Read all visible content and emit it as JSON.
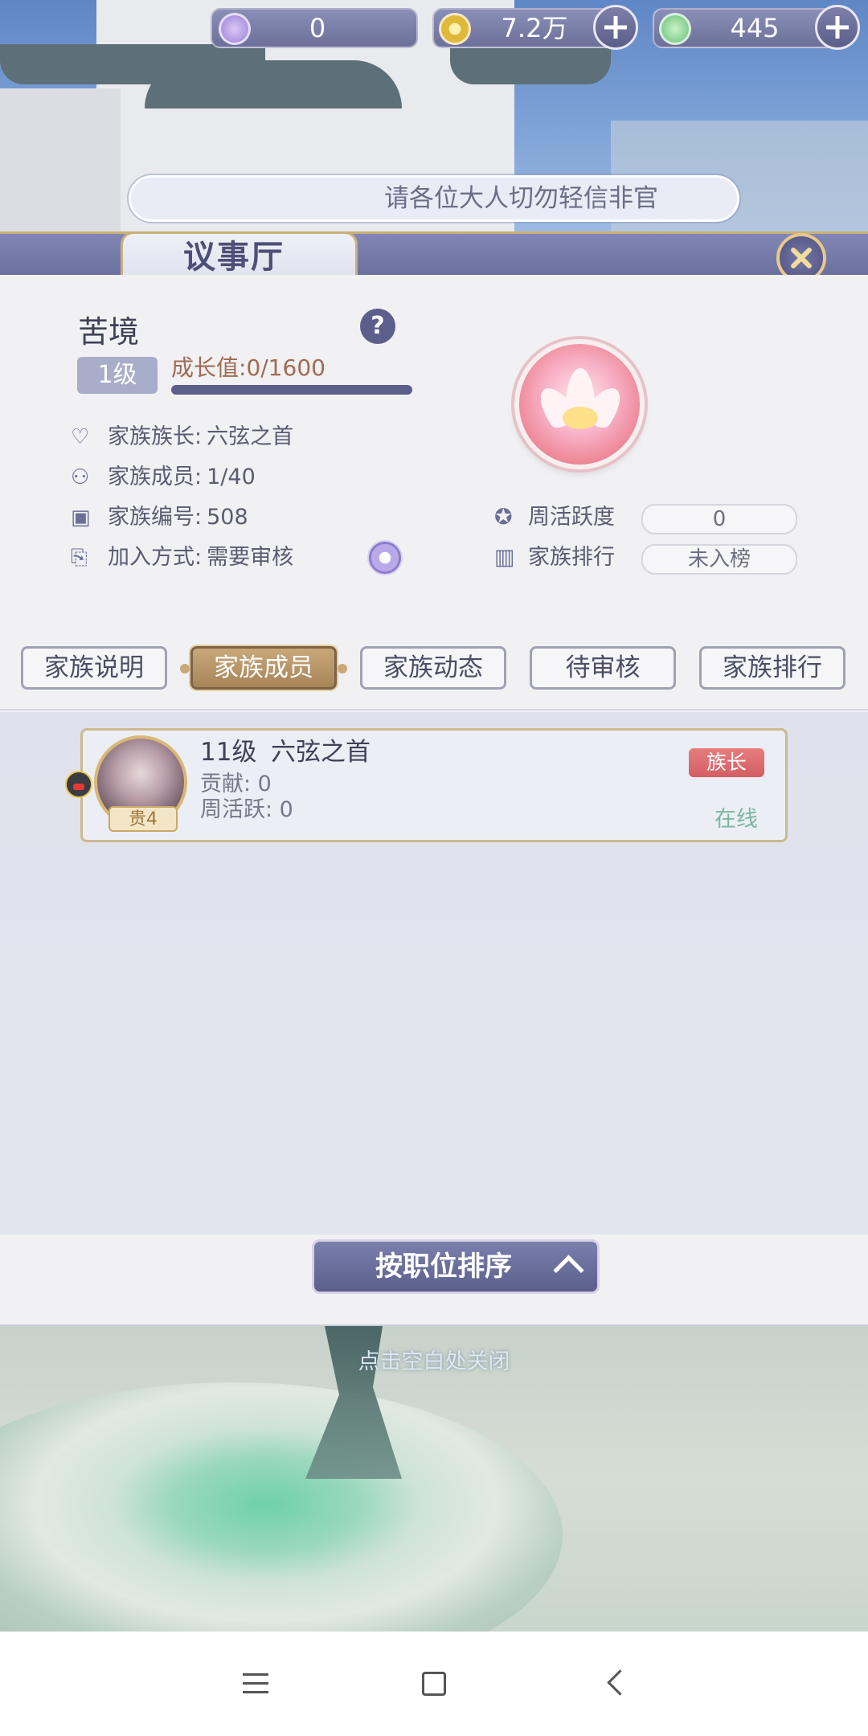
{
  "currency": {
    "gem": {
      "value": "0",
      "icon": "gem-icon"
    },
    "coin": {
      "value": "7.2万",
      "icon": "coin-icon"
    },
    "jade": {
      "value": "445",
      "icon": "jade-icon"
    }
  },
  "notice": {
    "text": "请各位大人切勿轻信非官"
  },
  "window": {
    "title": "议事厅"
  },
  "family": {
    "name": "苦境",
    "level": "1级",
    "growth_label": "成长值:",
    "growth_value": "0/1600",
    "growth_progress": 0.0,
    "leader_label": "家族族长:",
    "leader_value": "六弦之首",
    "members_label": "家族成员:",
    "members_value": "1/40",
    "id_label": "家族编号:",
    "id_value": "508",
    "join_label": "加入方式:",
    "join_value": "需要审核",
    "weekly_label": "周活跃度",
    "weekly_value": "0",
    "rank_label": "家族排行",
    "rank_value": "未入榜"
  },
  "tabs": [
    {
      "label": "家族说明",
      "active": false
    },
    {
      "label": "家族成员",
      "active": true
    },
    {
      "label": "家族动态",
      "active": false
    },
    {
      "label": "待审核",
      "active": false
    },
    {
      "label": "家族排行",
      "active": false
    }
  ],
  "members": [
    {
      "level": "11级",
      "name": "六弦之首",
      "rank_badge": "贵4",
      "contribution": "贡献: 0",
      "weekly": "周活跃: 0",
      "role": "族长",
      "status": "在线"
    }
  ],
  "sort_button": {
    "label": "按职位排序"
  },
  "close_hint": "点击空白处关闭",
  "colors": {
    "accent": "#5c5f8b",
    "gold": "#c9a77a",
    "leader": "#d35e64",
    "online": "#7cb6a1"
  }
}
